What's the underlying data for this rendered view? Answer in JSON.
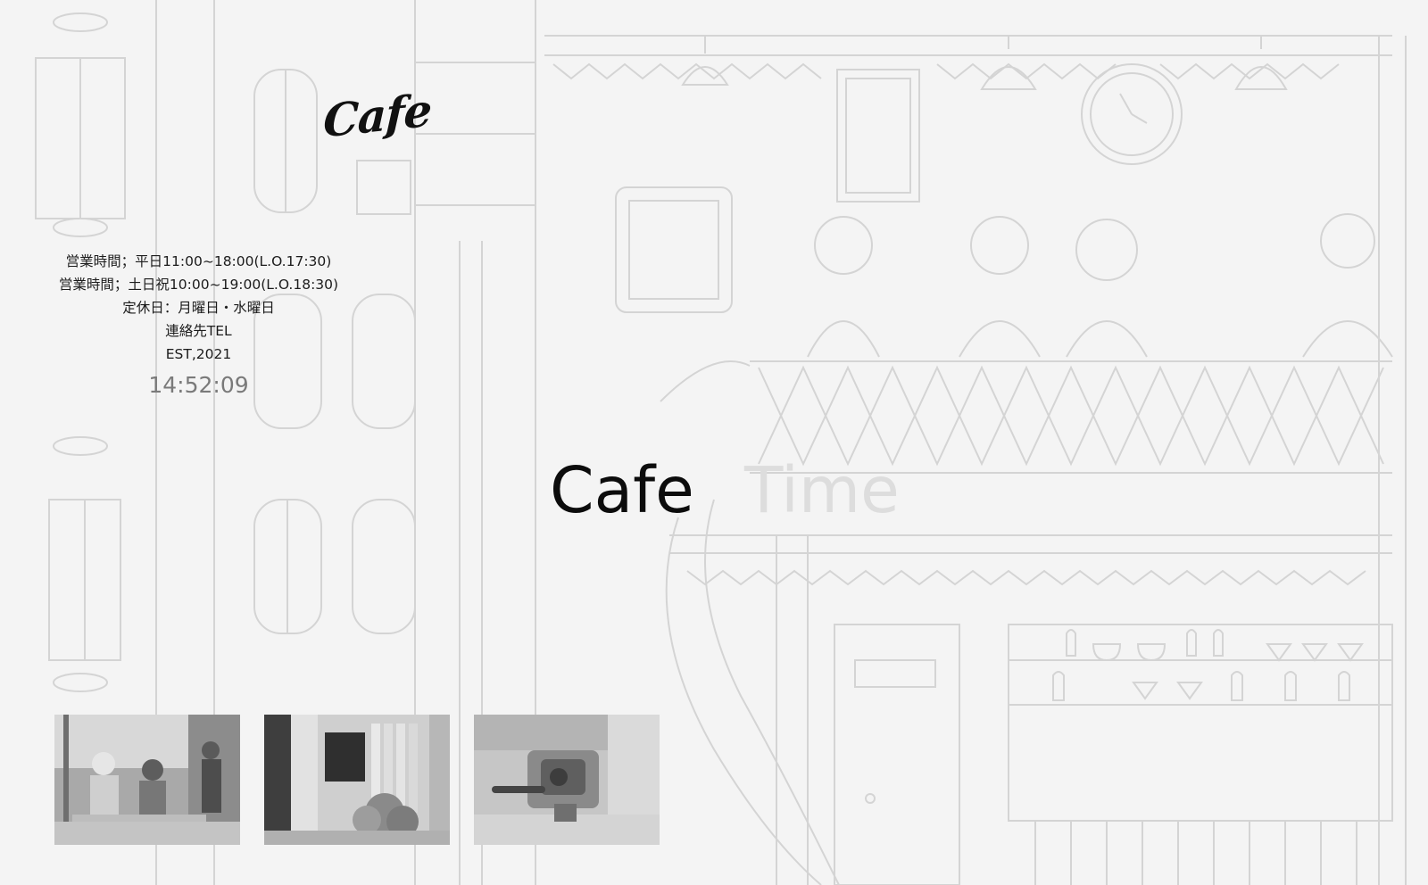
{
  "brand": {
    "logo_text": "Cafe"
  },
  "info": {
    "hours_weekday": "営業時間；平日11:00~18:00(L.O.17:30)",
    "hours_weekend": "営業時間；土日祝10:00~19:00(L.O.18:30)",
    "closed_days": "定休日：月曜日・水曜日",
    "contact": "連絡先TEL",
    "established": "EST,2021",
    "clock": "14:52:09"
  },
  "hero": {
    "word1": "Cafe",
    "word2": "Time"
  },
  "gallery": {
    "photos": [
      {
        "name": "cafe-interior-photo"
      },
      {
        "name": "cafe-storefront-photo"
      },
      {
        "name": "espresso-machine-photo"
      }
    ]
  },
  "colors": {
    "background": "#f4f4f4",
    "sketch_line": "#cfcfcf",
    "clock_text": "#7a7a7a",
    "hero_ghost": "#dddddd"
  }
}
